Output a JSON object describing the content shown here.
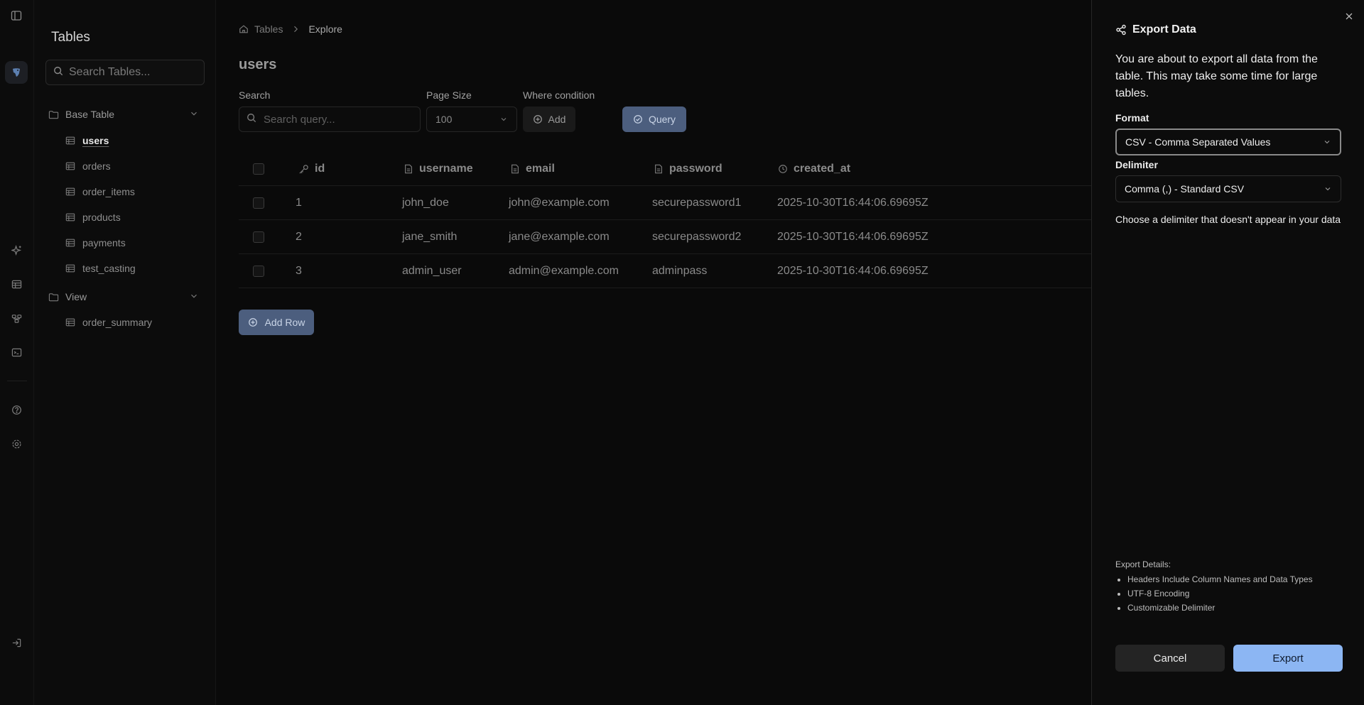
{
  "sidebar": {
    "title": "Tables",
    "search_placeholder": "Search Tables...",
    "groups": [
      {
        "label": "Base Table",
        "items": [
          "users",
          "orders",
          "order_items",
          "products",
          "payments",
          "test_casting"
        ]
      },
      {
        "label": "View",
        "items": [
          "order_summary"
        ]
      }
    ],
    "active_item": "users"
  },
  "breadcrumb": {
    "root": "Tables",
    "current": "Explore"
  },
  "main": {
    "page_title": "users",
    "search_label": "Search",
    "search_placeholder": "Search query...",
    "page_size_label": "Page Size",
    "page_size_value": "100",
    "where_label": "Where condition",
    "add_label": "Add",
    "query_label": "Query",
    "add_row_label": "Add Row"
  },
  "table": {
    "columns": [
      {
        "name": "id",
        "icon": "key-icon"
      },
      {
        "name": "username",
        "icon": "file-text-icon"
      },
      {
        "name": "email",
        "icon": "file-text-icon"
      },
      {
        "name": "password",
        "icon": "file-text-icon"
      },
      {
        "name": "created_at",
        "icon": "clock-icon"
      }
    ],
    "rows": [
      [
        "1",
        "john_doe",
        "john@example.com",
        "securepassword1",
        "2025-10-30T16:44:06.69695Z"
      ],
      [
        "2",
        "jane_smith",
        "jane@example.com",
        "securepassword2",
        "2025-10-30T16:44:06.69695Z"
      ],
      [
        "3",
        "admin_user",
        "admin@example.com",
        "adminpass",
        "2025-10-30T16:44:06.69695Z"
      ]
    ]
  },
  "export_panel": {
    "title": "Export Data",
    "description": "You are about to export all data from the table. This may take some time for large tables.",
    "format_label": "Format",
    "format_value": "CSV - Comma Separated Values",
    "delimiter_label": "Delimiter",
    "delimiter_value": "Comma (,) - Standard CSV",
    "delimiter_hint": "Choose a delimiter that doesn't appear in your data",
    "details_title": "Export Details:",
    "details": [
      "Headers Include Column Names and Data Types",
      "UTF-8 Encoding",
      "Customizable Delimiter"
    ],
    "cancel_label": "Cancel",
    "export_label": "Export"
  },
  "colors": {
    "accent": "#8cb6f3",
    "button_muted": "#4c5e7e"
  }
}
